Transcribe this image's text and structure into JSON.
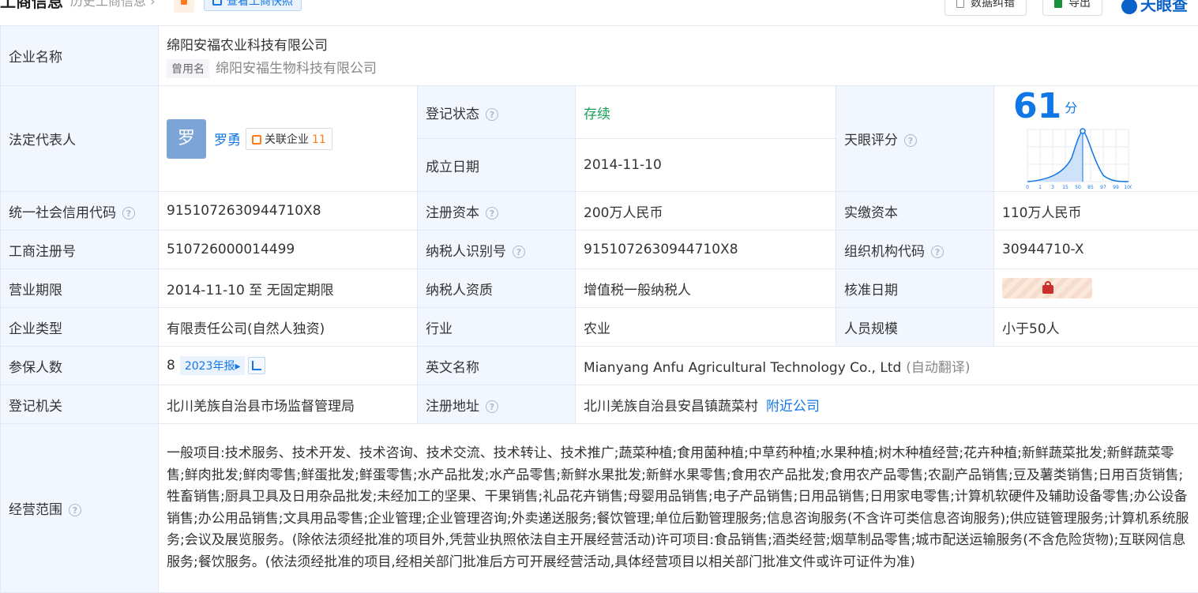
{
  "header": {
    "title": "工商信息",
    "history": "历史工商信息 ›",
    "snapshot": "查看工商快照",
    "error_report": "数据纠错",
    "export": "导出",
    "logo": "天眼查"
  },
  "company": {
    "name_label": "企业名称",
    "name": "绵阳安福农业科技有限公司",
    "former_tag": "曾用名",
    "former_name": "绵阳安福生物科技有限公司",
    "legal_label": "法定代表人",
    "legal_avatar": "罗",
    "legal_name": "罗勇",
    "related_label": "关联企业",
    "related_count": "11",
    "status_label": "登记状态",
    "status": "存续",
    "founded_label": "成立日期",
    "founded": "2014-11-10",
    "score_label": "天眼评分",
    "score": "61",
    "score_unit": "分",
    "score_axis": [
      "0",
      "1",
      "3",
      "15",
      "50",
      "85",
      "97",
      "99",
      "100"
    ],
    "credit_label": "统一社会信用代码",
    "credit_code": "9151072630944710X8",
    "reg_capital_label": "注册资本",
    "reg_capital": "200万人民币",
    "paid_capital_label": "实缴资本",
    "paid_capital": "110万人民币",
    "reg_no_label": "工商注册号",
    "reg_no": "510726000014499",
    "taxpayer_id_label": "纳税人识别号",
    "taxpayer_id": "9151072630944710X8",
    "org_code_label": "组织机构代码",
    "org_code": "30944710-X",
    "term_label": "营业期限",
    "term": "2014-11-10 至 无固定期限",
    "taxpayer_qual_label": "纳税人资质",
    "taxpayer_qual": "增值税一般纳税人",
    "approve_label": "核准日期",
    "type_label": "企业类型",
    "type": "有限责任公司(自然人独资)",
    "industry_label": "行业",
    "industry": "农业",
    "staff_label": "人员规模",
    "staff": "小于50人",
    "insured_label": "参保人数",
    "insured": "8",
    "insured_year": "2023年报▸",
    "en_name_label": "英文名称",
    "en_name": "Mianyang Anfu Agricultural Technology Co., Ltd",
    "auto_translate": "(自动翻译)",
    "authority_label": "登记机关",
    "authority": "北川羌族自治县市场监督管理局",
    "address_label": "注册地址",
    "address": "北川羌族自治县安昌镇蔬菜村",
    "nearby": "附近公司",
    "scope_label": "经营范围",
    "scope": "一般项目:技术服务、技术开发、技术咨询、技术交流、技术转让、技术推广;蔬菜种植;食用菌种植;中草药种植;水果种植;树木种植经营;花卉种植;新鲜蔬菜批发;新鲜蔬菜零售;鲜肉批发;鲜肉零售;鲜蛋批发;鲜蛋零售;水产品批发;水产品零售;新鲜水果批发;新鲜水果零售;食用农产品批发;食用农产品零售;农副产品销售;豆及薯类销售;日用百货销售;牲畜销售;厨具卫具及日用杂品批发;未经加工的坚果、干果销售;礼品花卉销售;母婴用品销售;电子产品销售;日用品销售;日用家电零售;计算机软硬件及辅助设备零售;办公设备销售;办公用品销售;文具用品零售;企业管理;企业管理咨询;外卖递送服务;餐饮管理;单位后勤管理服务;信息咨询服务(不含许可类信息咨询服务);供应链管理服务;计算机系统服务;会议及展览服务。(除依法须经批准的项目外,凭营业执照依法自主开展经营活动)许可项目:食品销售;酒类经营;烟草制品零售;城市配送运输服务(不含危险货物);互联网信息服务;餐饮服务。(依法须经批准的项目,经相关部门批准后方可开展经营活动,具体经营项目以相关部门批准文件或许可证件为准)"
  }
}
